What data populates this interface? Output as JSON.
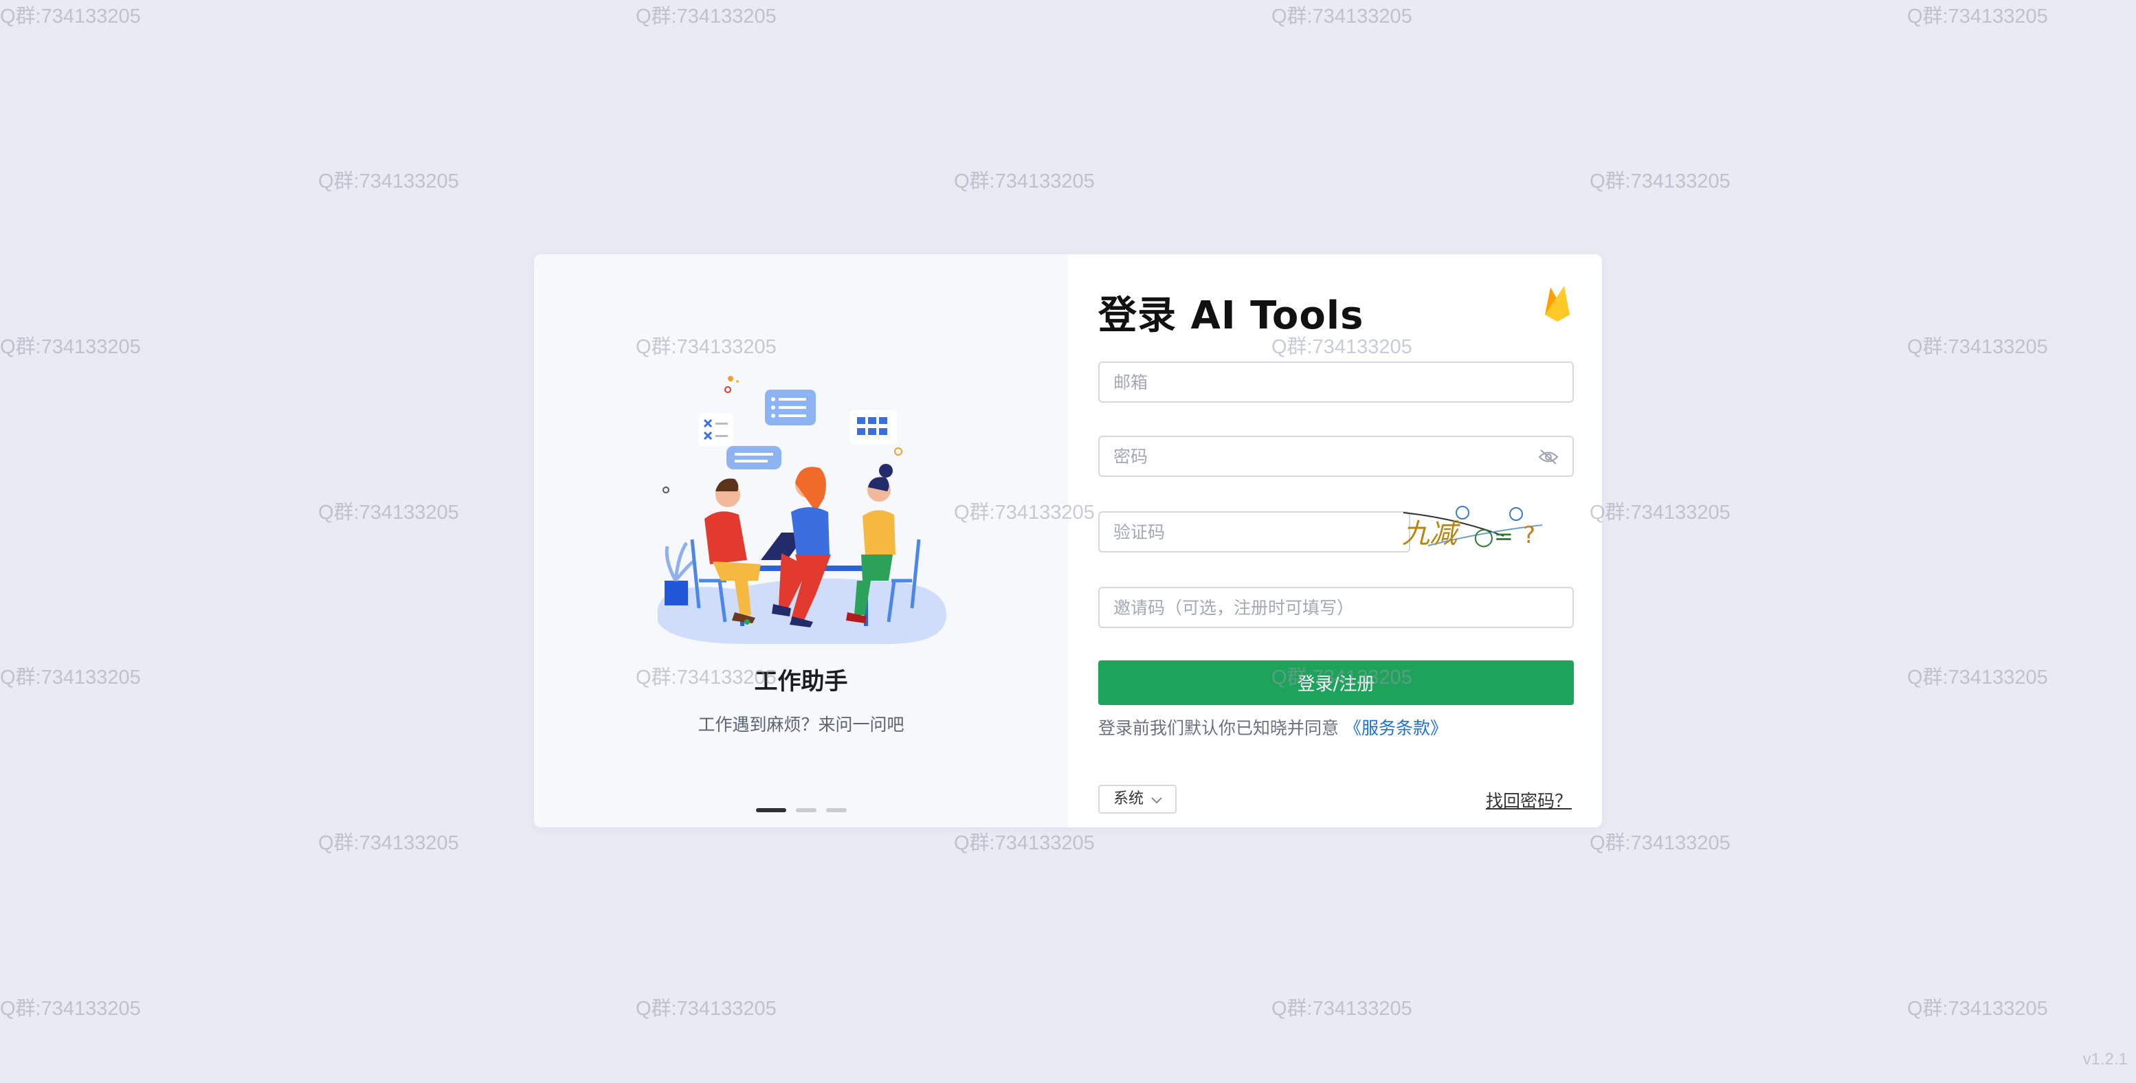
{
  "watermark": "Q群:734133205",
  "version": "v1.2.1",
  "carousel": {
    "title": "工作助手",
    "subtitle": "工作遇到麻烦？来问一问吧",
    "slides": 3,
    "active_index": 0
  },
  "login": {
    "title": "登录 AI Tools",
    "email_placeholder": "邮箱",
    "password_placeholder": "密码",
    "captcha_placeholder": "验证码",
    "invite_placeholder": "邀请码（可选，注册时可填写）",
    "captcha_text": "九减",
    "submit_label": "登录/注册",
    "terms_text": "登录前我们默认你已知晓并同意",
    "terms_link": "《服务条款》",
    "system_select": "系统",
    "forgot_link": "找回密码？"
  },
  "colors": {
    "background": "#e9eaf3",
    "primary_button": "#1ea35a",
    "link": "#1f6fd6"
  }
}
